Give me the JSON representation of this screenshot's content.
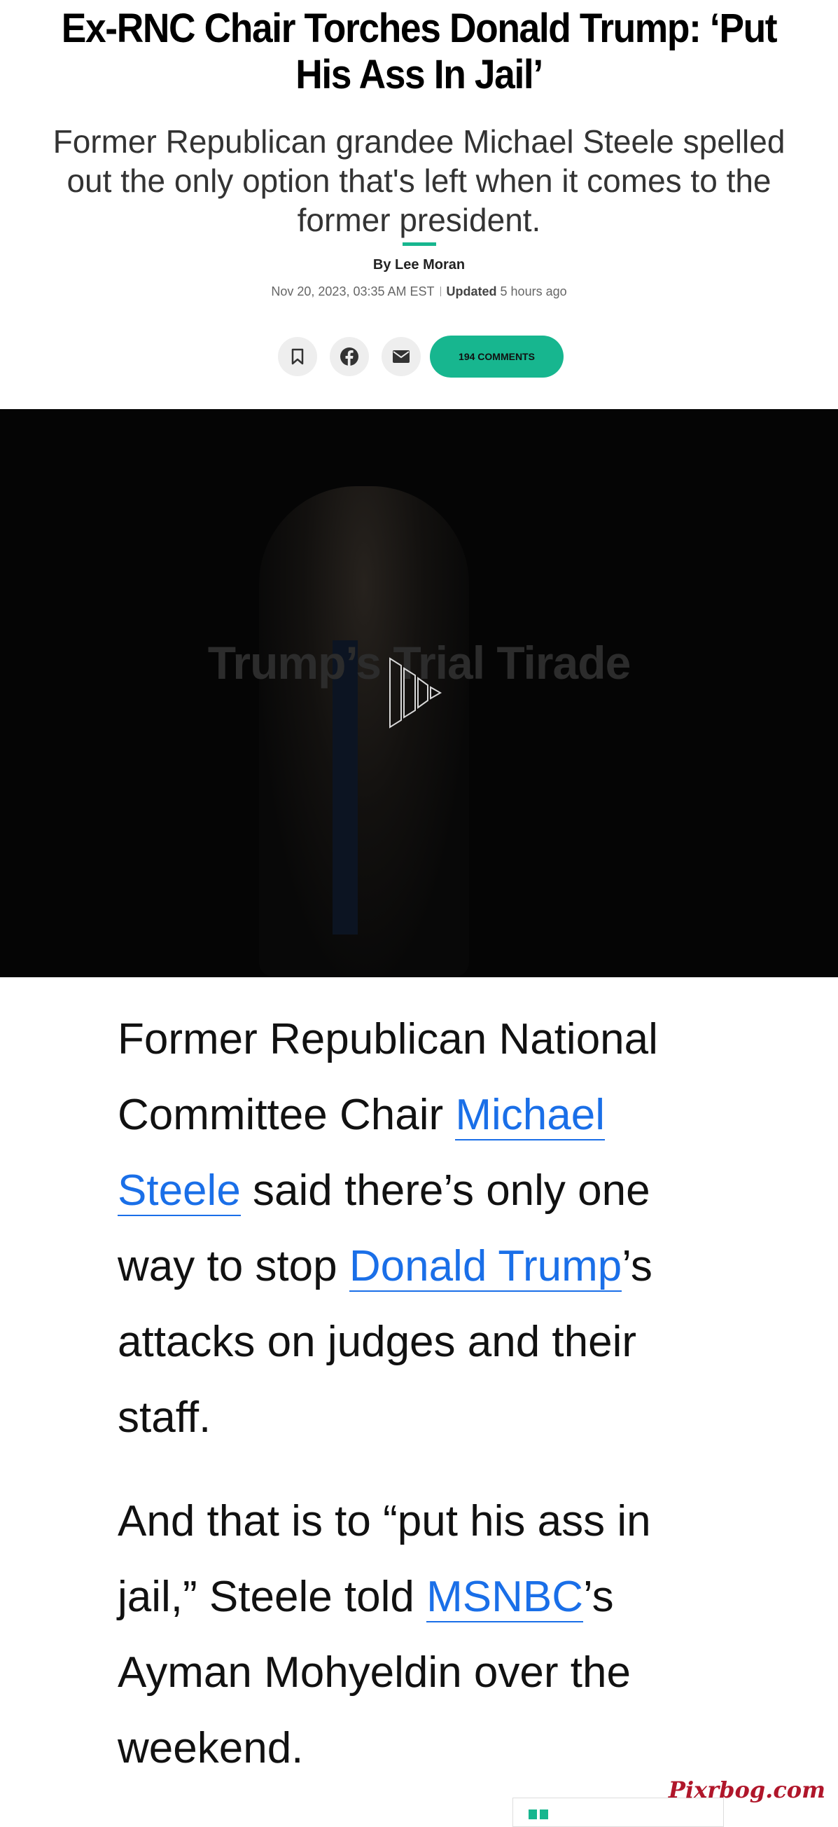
{
  "headline": "Ex-RNC Chair Torches Donald Trump: ‘Put His Ass In Jail’",
  "dek": "Former Republican grandee Michael Steele spelled out the only option that's left when it comes to the former president.",
  "byline": "By Lee Moran",
  "dateline": {
    "published": "Nov 20, 2023, 03:35 AM EST",
    "updated_label": "Updated",
    "updated_value": "5 hours ago"
  },
  "share": {
    "comments_label": "194 COMMENTS"
  },
  "video": {
    "overlay_title": "Trump’s Trial Tirade"
  },
  "article": {
    "p1_before": "Former Republican National Committee Chair ",
    "p1_link1": "Michael Steele",
    "p1_mid": " said there’s only one way to stop ",
    "p1_link2": "Donald Trump",
    "p1_after": "’s attacks on judges and their staff.",
    "p2_before": "And that is to “put his ass in jail,” Steele told ",
    "p2_link": "MSNBC",
    "p2_after": "’s Ayman Mohyeldin over the weekend."
  },
  "watermark": "Pixrbog.com",
  "colors": {
    "accent": "#17b68f",
    "link": "#1a6fe8",
    "watermark": "#b0162a"
  },
  "icons": [
    "bookmark-icon",
    "facebook-icon",
    "email-icon",
    "play-icon"
  ]
}
